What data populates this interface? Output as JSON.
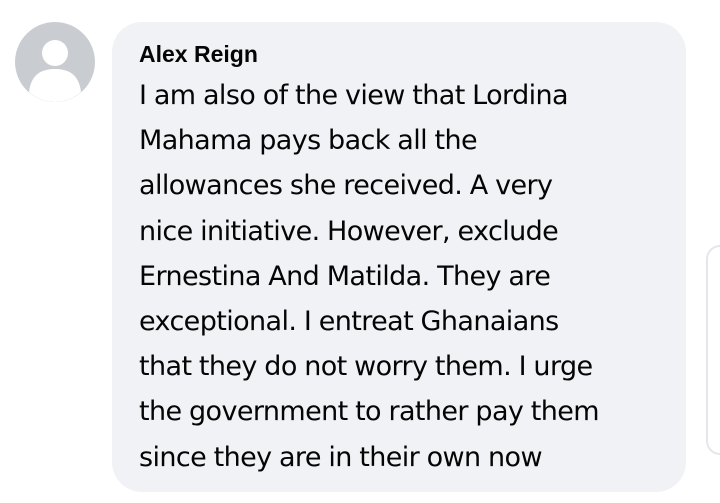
{
  "comment": {
    "author": "Alex Reign",
    "avatar_icon": "default-user-silhouette-icon",
    "text_lines": [
      "I am also of the view that Lordina",
      "Mahama pays back all the",
      "allowances she received. A very",
      "nice initiative. However, exclude",
      "Ernestina And Matilda. They are",
      "exceptional. I entreat Ghanaians",
      "that they do not worry them. I urge",
      "the government to rather pay them",
      "since they are in their own now"
    ]
  },
  "colors": {
    "bubble_background": "#f0f2f5",
    "avatar_background": "#c9ccd1",
    "text": "#050505"
  }
}
